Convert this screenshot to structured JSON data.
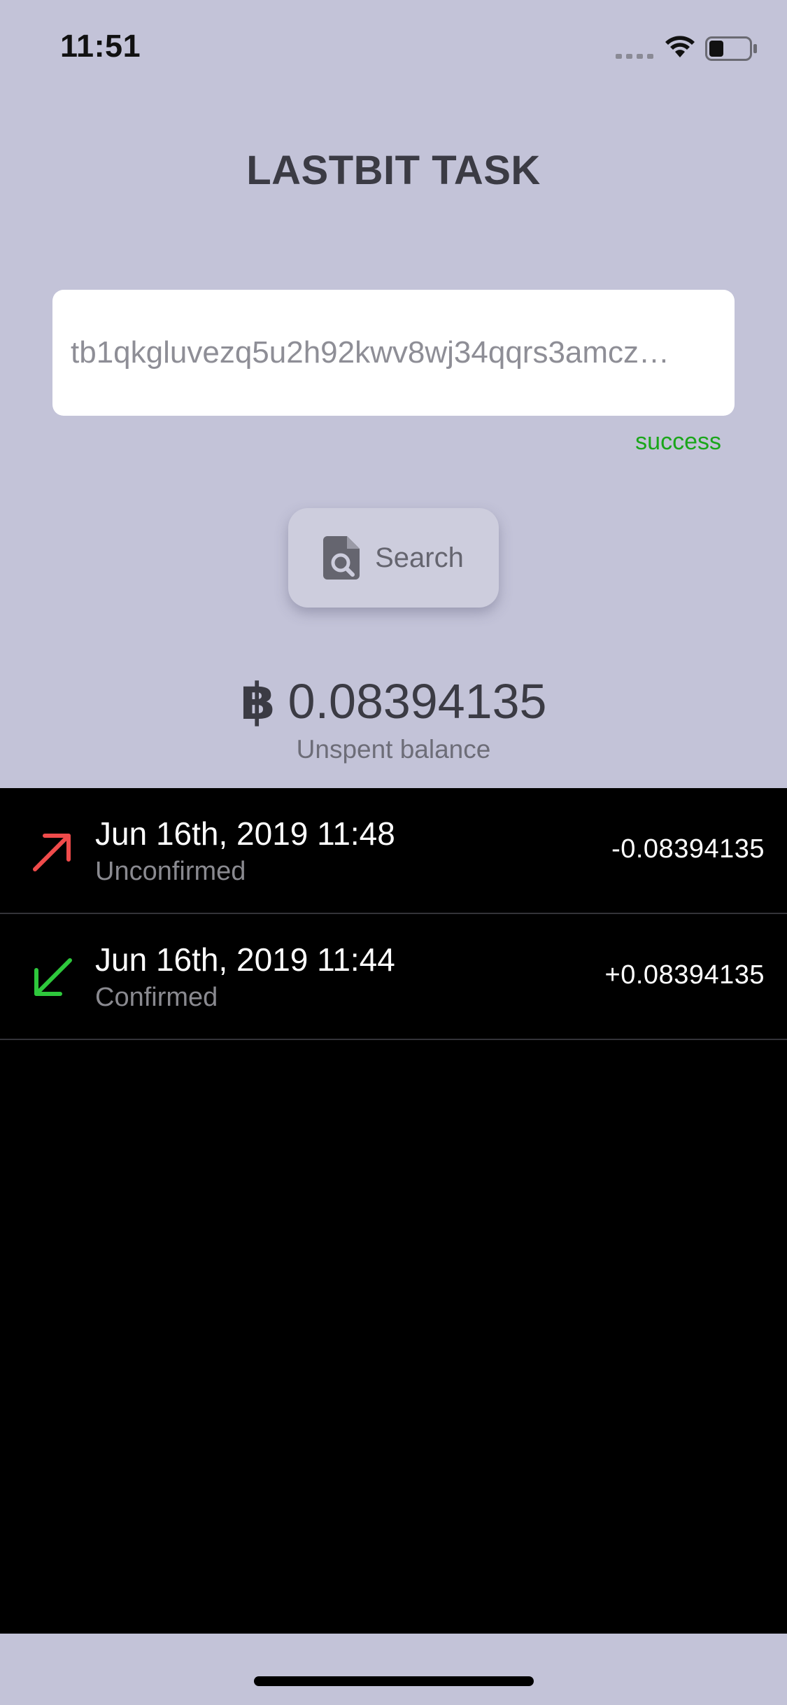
{
  "status_bar": {
    "time": "11:51",
    "icons": [
      "signal-icon",
      "wifi-icon",
      "battery-icon"
    ]
  },
  "header": {
    "title": "LASTBIT TASK"
  },
  "address": {
    "value": "tb1qkgluvezq5u2h92kwv8wj34qqrs3amczxxxxxxxx",
    "display": "tb1qkgluvezq5u2h92kwv8wj34qqrs3amcz…",
    "status": "success",
    "status_color": "#1aa61a"
  },
  "search": {
    "label": "Search",
    "icon": "file-search-icon"
  },
  "balance": {
    "symbol": "฿",
    "value": "0.08394135",
    "caption": "Unspent balance"
  },
  "transactions": [
    {
      "direction": "outgoing",
      "icon": "arrow-up-right-icon",
      "color": "#f04b4b",
      "date": "Jun 16th, 2019 11:48",
      "status": "Unconfirmed",
      "amount": "-0.08394135"
    },
    {
      "direction": "incoming",
      "icon": "arrow-down-left-icon",
      "color": "#2ec83c",
      "date": "Jun 16th, 2019 11:44",
      "status": "Confirmed",
      "amount": "+0.08394135"
    }
  ],
  "colors": {
    "background": "#c3c3d8",
    "list_background": "#000000",
    "title": "#3b3b44"
  }
}
